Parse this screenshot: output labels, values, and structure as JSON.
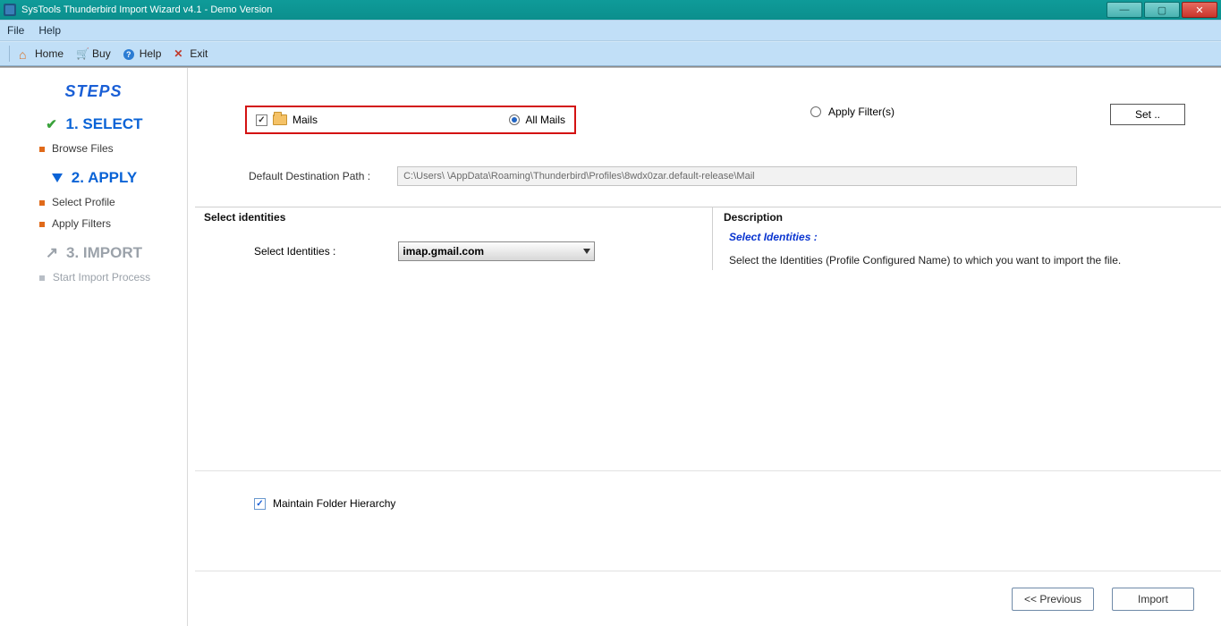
{
  "window": {
    "title": "SysTools Thunderbird Import Wizard v4.1 - Demo Version"
  },
  "menubar": {
    "file": "File",
    "help": "Help"
  },
  "toolbar": {
    "home": "Home",
    "buy": "Buy",
    "help": "Help",
    "exit": "Exit"
  },
  "sidebar": {
    "header": "STEPS",
    "step1": {
      "label": "1. SELECT",
      "sub1": "Browse Files"
    },
    "step2": {
      "label": "2. APPLY",
      "sub1": "Select Profile",
      "sub2": "Apply Filters"
    },
    "step3": {
      "label": "3. IMPORT",
      "sub1": "Start Import Process"
    }
  },
  "options": {
    "mails_label": "Mails",
    "all_mails_label": "All Mails",
    "apply_filter_label": "Apply Filter(s)",
    "set_button": "Set .."
  },
  "destination": {
    "label": "Default Destination Path :",
    "value": "C:\\Users\\        \\AppData\\Roaming\\Thunderbird\\Profiles\\8wdx0zar.default-release\\Mail"
  },
  "identities": {
    "legend": "Select identities",
    "label": "Select Identities :",
    "selected": "imap.gmail.com"
  },
  "description": {
    "legend": "Description",
    "subhead": "Select Identities :",
    "body": "Select the Identities (Profile Configured Name) to  which  you want to import the file."
  },
  "maintain_label": "Maintain Folder Hierarchy",
  "footer": {
    "prev": "<< Previous",
    "import": "Import"
  }
}
